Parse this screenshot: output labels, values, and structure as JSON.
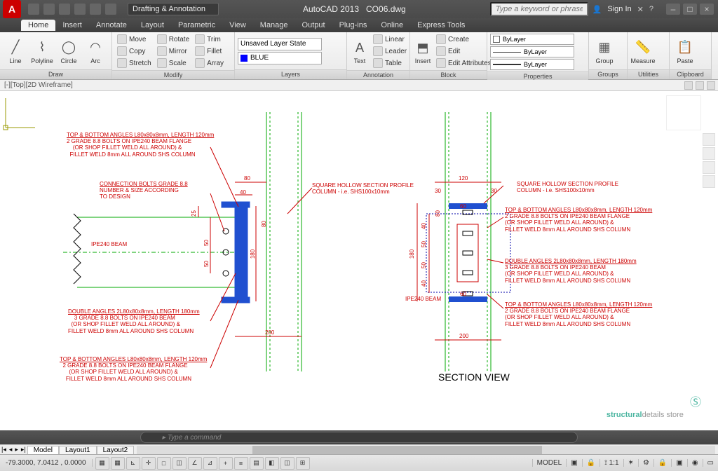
{
  "title": {
    "app": "AutoCAD 2013",
    "file": "CO06.dwg"
  },
  "workspace": "Drafting & Annotation",
  "search_placeholder": "Type a keyword or phrase",
  "signin": "Sign In",
  "menutabs": [
    "Home",
    "Insert",
    "Annotate",
    "Layout",
    "Parametric",
    "View",
    "Manage",
    "Output",
    "Plug-ins",
    "Online",
    "Express Tools"
  ],
  "active_tab": "Home",
  "ribbon": {
    "draw": {
      "label": "Draw",
      "items": [
        "Line",
        "Polyline",
        "Circle",
        "Arc"
      ]
    },
    "modify": {
      "label": "Modify",
      "move": "Move",
      "rotate": "Rotate",
      "trim": "Trim",
      "copy": "Copy",
      "mirror": "Mirror",
      "fillet": "Fillet",
      "stretch": "Stretch",
      "scale": "Scale",
      "array": "Array"
    },
    "layers": {
      "label": "Layers",
      "state": "Unsaved Layer State",
      "current": "BLUE"
    },
    "annotation": {
      "label": "Annotation",
      "text": "Text",
      "linear": "Linear",
      "leader": "Leader",
      "table": "Table"
    },
    "block": {
      "label": "Block",
      "insert": "Insert",
      "create": "Create",
      "edit": "Edit",
      "editattr": "Edit Attributes"
    },
    "properties": {
      "label": "Properties",
      "bylayer": "ByLayer"
    },
    "groups": {
      "label": "Groups",
      "group": "Group"
    },
    "utilities": {
      "label": "Utilities",
      "measure": "Measure"
    },
    "clipboard": {
      "label": "Clipboard",
      "paste": "Paste"
    }
  },
  "vplabel": "[-][Top][2D Wireframe]",
  "drawing": {
    "section_label": "SECTION VIEW",
    "beam_label_left": "IPE240 BEAM",
    "beam_label_right": "IPE240 BEAM",
    "dims": {
      "d80": "80",
      "d40": "40",
      "d25": "25",
      "d50a": "50",
      "d50b": "50",
      "d180": "180",
      "d200": "200",
      "d60": "60",
      "d120": "120",
      "d30a": "30",
      "d30b": "30",
      "d40r1": "40",
      "d40r2": "40",
      "d50r1": "50",
      "d50r2": "50",
      "d80r": "80"
    },
    "notes": {
      "tb_angles": {
        "u": "TOP & BOTTOM ANGLES L80x80x8mm, LENGTH 120mm",
        "l2": "2 GRADE 8.8 BOLTS ON IPE240 BEAM FLANGE",
        "l3": "(OR SHOP FILLET WELD ALL AROUND) &",
        "l4": "FILLET WELD 8mm ALL AROUND SHS COLUMN"
      },
      "conn_bolts": {
        "u": "CONNECTION BOLTS GRADE 8.8",
        "l2": "NUMBER & SIZE ACCORDING",
        "l3": "TO DESIGN"
      },
      "dbl_angles": {
        "u": "DOUBLE ANGLES 2L80x80x8mm, LENGTH 180mm",
        "l2": "3 GRADE 8.8 BOLTS ON IPE240 BEAM",
        "l3": "(OR SHOP FILLET WELD ALL AROUND) &",
        "l4": "FILLET WELD 8mm ALL AROUND SHS COLUMN"
      },
      "shs": {
        "l1": "SQUARE HOLLOW SECTION PROFILE",
        "l2": "COLUMN - i.e. SHS100x10mm"
      }
    },
    "watermark": {
      "b": "structural",
      "m": "details",
      "s": " store"
    }
  },
  "layout_tabs": [
    "Model",
    "Layout1",
    "Layout2"
  ],
  "cmd_placeholder": "Type a command",
  "status": {
    "coords": "-79.3000, 7.0412 , 0.0000",
    "model": "MODEL",
    "scale": "1:1"
  }
}
